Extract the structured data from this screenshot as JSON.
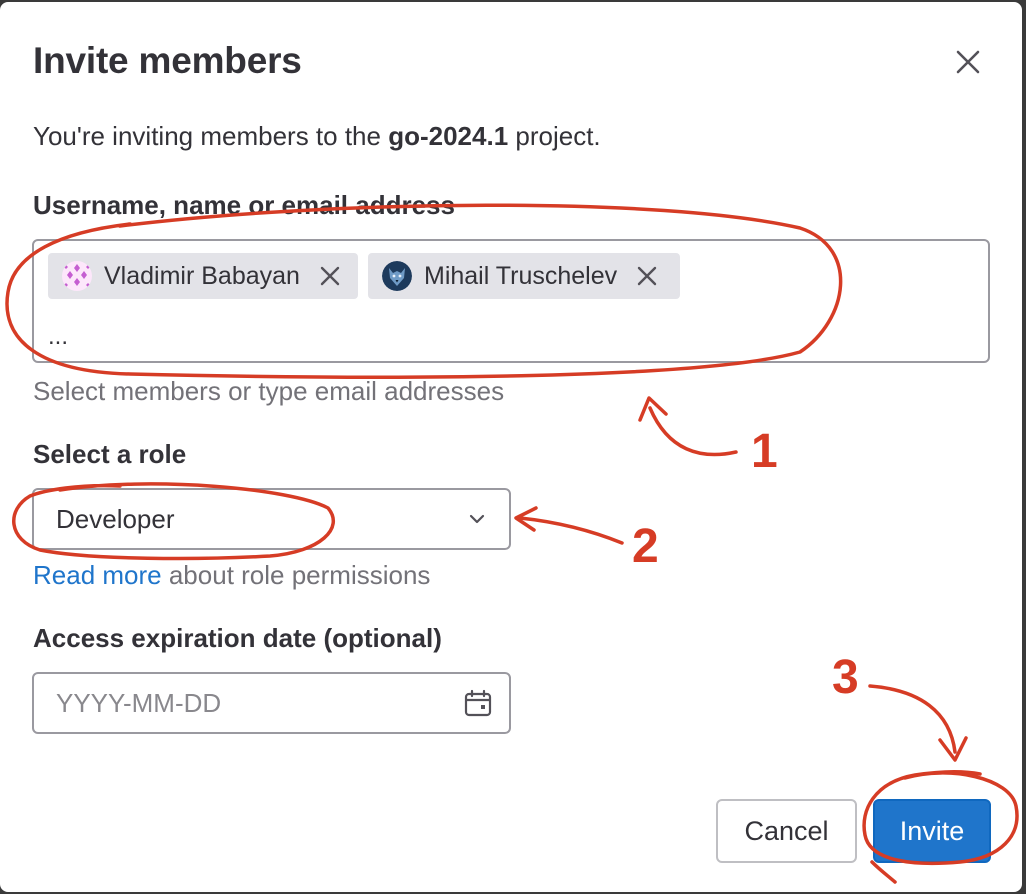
{
  "modal": {
    "title": "Invite members",
    "intro_prefix": "You're inviting members to the ",
    "project_name": "go-2024.1",
    "intro_suffix": " project."
  },
  "members_field": {
    "label": "Username, name or email address",
    "tokens": [
      {
        "name": "Vladimir Babayan",
        "avatar": "pink-pattern-avatar"
      },
      {
        "name": "Mihail Truschelev",
        "avatar": "wolf-avatar"
      }
    ],
    "input_value": "...",
    "helper": "Select members or type email addresses"
  },
  "role_field": {
    "label": "Select a role",
    "selected": "Developer",
    "help_link": "Read more",
    "help_text": " about role permissions"
  },
  "expiration_field": {
    "label": "Access expiration date (optional)",
    "placeholder": "YYYY-MM-DD"
  },
  "buttons": {
    "cancel": "Cancel",
    "invite": "Invite"
  },
  "annotations": {
    "labels": [
      "1",
      "2",
      "3"
    ],
    "color": "#d63c25"
  },
  "colors": {
    "primary": "#1f75cb",
    "link": "#1f75cb",
    "token_bg": "#e3e3e8"
  }
}
